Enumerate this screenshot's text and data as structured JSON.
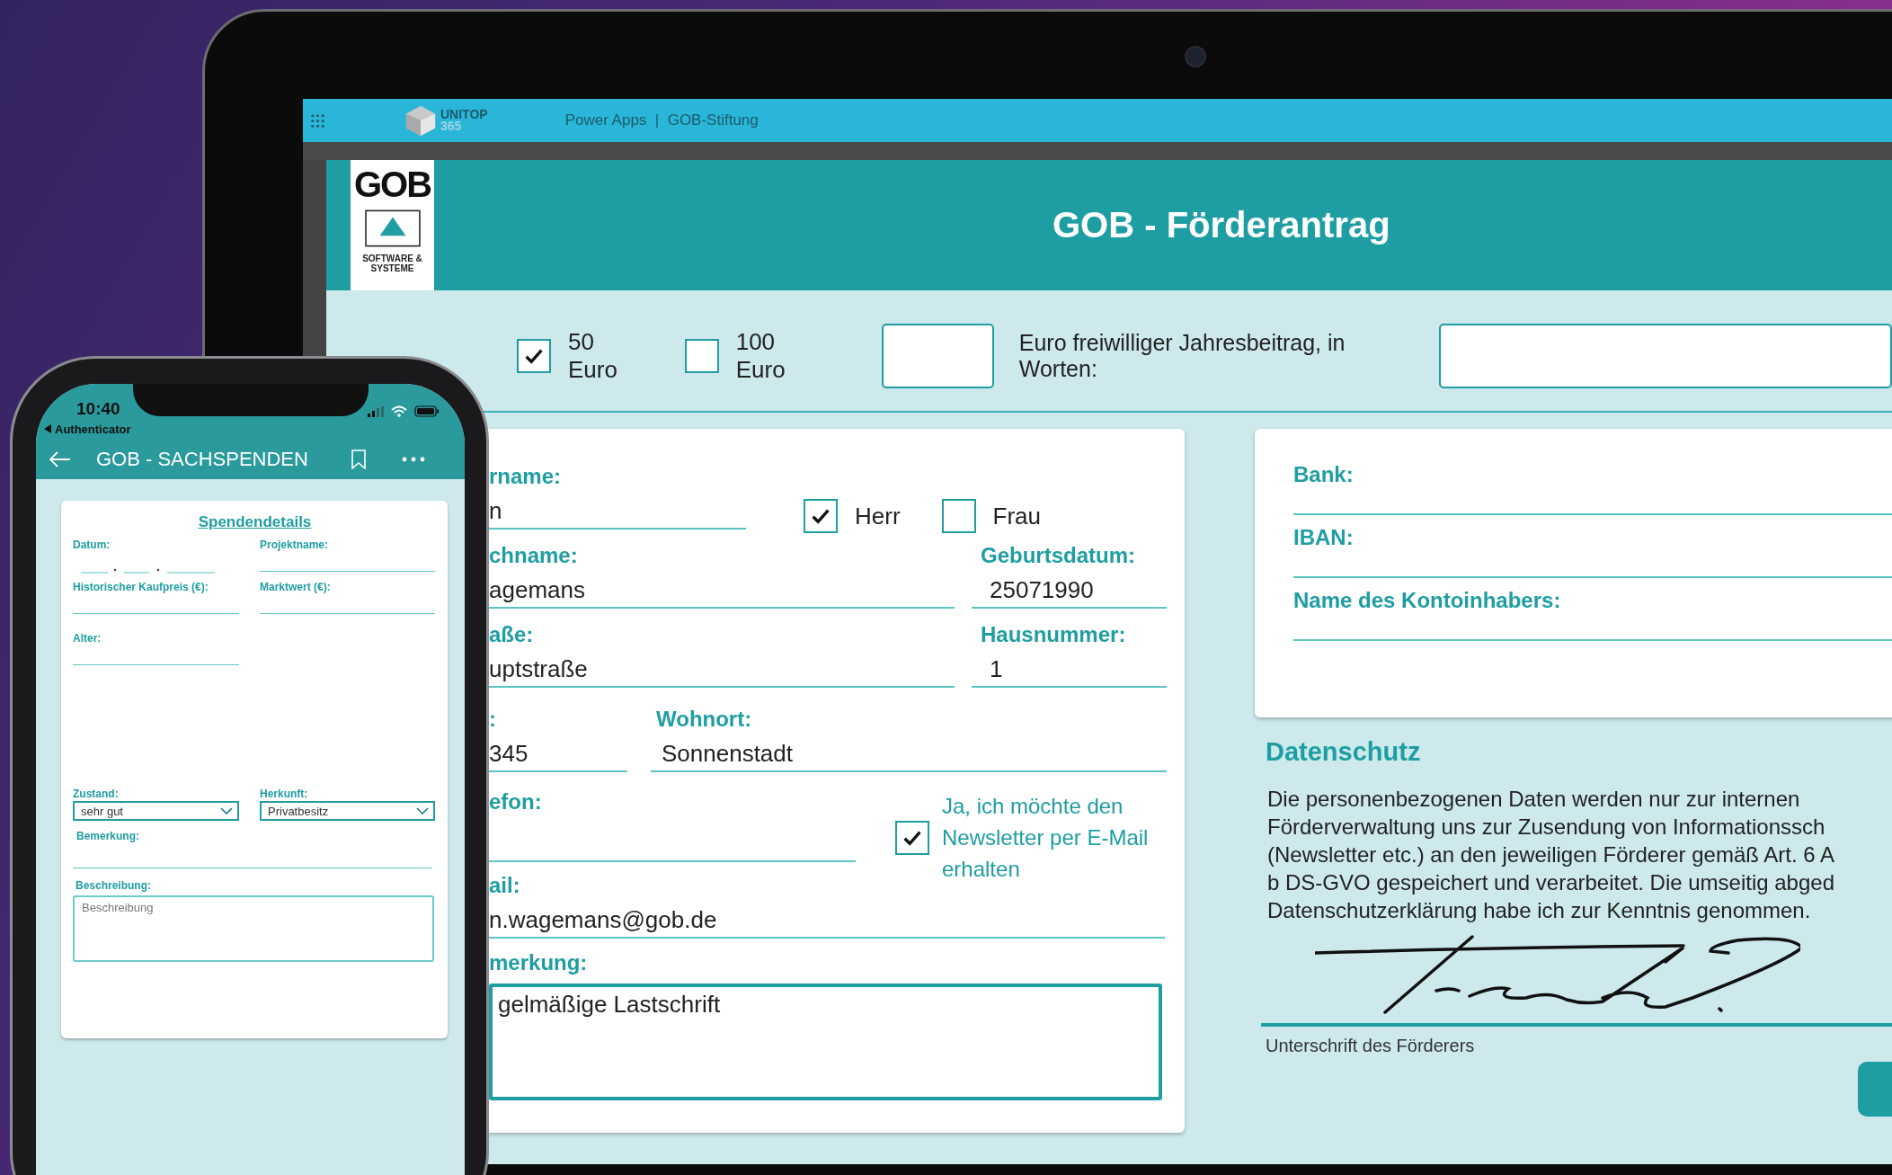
{
  "laptop": {
    "top_bar": {
      "brand": "UNITOP",
      "brand_sub": "365",
      "breadcrumb": "Power Apps  |  GOB-Stiftung"
    },
    "header": {
      "logo_text": "GOB",
      "logo_subtext": "SOFTWARE & SYSTEME",
      "title": "GOB - Förderantrag"
    },
    "amount": {
      "options": [
        {
          "label": "50 Euro",
          "checked": true
        },
        {
          "label": "100 Euro",
          "checked": false
        }
      ],
      "amount_label": "Euro freiwilliger Jahresbeitrag, in Worten:"
    },
    "personal": {
      "first_name": {
        "label": "rname:",
        "value": "n"
      },
      "salutation": [
        {
          "label": "Herr",
          "checked": true
        },
        {
          "label": "Frau",
          "checked": false
        }
      ],
      "last_name": {
        "label": "chname:",
        "value": "agemans"
      },
      "birth_date": {
        "label": "Geburtsdatum:",
        "value": "25071990"
      },
      "street": {
        "label": "aße:",
        "value": "uptstraße"
      },
      "house_number": {
        "label": "Hausnummer:",
        "value": "1"
      },
      "postcode": {
        "label": ":",
        "value": "345"
      },
      "city": {
        "label": "Wohnort:",
        "value": "Sonnenstadt"
      },
      "phone": {
        "label": "efon:"
      },
      "newsletter": {
        "label": "Ja, ich möchte den Newsletter per E-Mail erhalten",
        "checked": true
      },
      "email": {
        "label": "ail:",
        "value": "n.wagemans@gob.de"
      },
      "remark": {
        "label": "merkung:",
        "value": "gelmäßige Lastschrift"
      }
    },
    "bank": {
      "fields": [
        {
          "label": "Bank:"
        },
        {
          "label": "IBAN:"
        },
        {
          "label": "Name des Kontoinhabers:"
        }
      ]
    },
    "privacy": {
      "title": "Datenschutz",
      "text": "Die personenbezogenen Daten werden nur zur internen\nFörderverwaltung uns zur Zusendung von Informationssch\n(Newsletter etc.) an den jeweiligen Förderer gemäß Art. 6 A\nb DS-GVO gespeichert und verarbeitet. Die umseitig abged\nDatenschutzerklärung habe ich zur Kenntnis genommen.",
      "signature_caption": "Unterschrift des Förderers"
    }
  },
  "phone": {
    "time": "10:40",
    "back_app": "Authenticator",
    "title": "GOB - SACHSPENDEN",
    "card": {
      "title": "Spendendetails",
      "date": {
        "label": "Datum:"
      },
      "project": {
        "label": "Projektname:"
      },
      "price": {
        "label": "Historischer Kaufpreis (€):"
      },
      "market": {
        "label": "Marktwert (€):"
      },
      "age": {
        "label": "Alter:"
      },
      "condition": {
        "label": "Zustand:",
        "value": "sehr gut"
      },
      "origin": {
        "label": "Herkunft:",
        "value": "Privatbesitz"
      },
      "remark": {
        "label": "Bemerkung:"
      },
      "description": {
        "label": "Beschreibung:",
        "placeholder": "Beschreibung"
      }
    }
  }
}
